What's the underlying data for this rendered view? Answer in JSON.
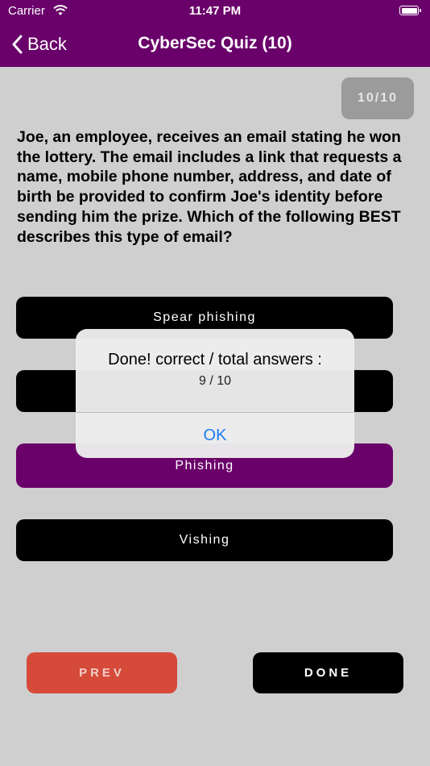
{
  "status": {
    "carrier": "Carrier",
    "time": "11:47 PM"
  },
  "nav": {
    "back_label": "Back",
    "title": "CyberSec Quiz (10)"
  },
  "counter": "10/10",
  "question": "Joe, an employee, receives an email stating he won the lottery. The email includes a link that requests a name, mobile phone number, address, and date of birth be provided to confirm Joe's identity before sending him the prize. Which of the following BEST describes this type of email?",
  "answers": [
    {
      "label": "Spear phishing",
      "selected": false
    },
    {
      "label": "",
      "selected": false
    },
    {
      "label": "Phishing",
      "selected": true
    },
    {
      "label": "Vishing",
      "selected": false
    }
  ],
  "buttons": {
    "prev": "PREV",
    "done": "DONE"
  },
  "alert": {
    "title": "Done! correct / total answers :",
    "message": "9 / 10",
    "ok": "OK"
  },
  "colors": {
    "brand": "#6a006a",
    "prev": "#d64a3a",
    "ok": "#1a7cf5"
  }
}
